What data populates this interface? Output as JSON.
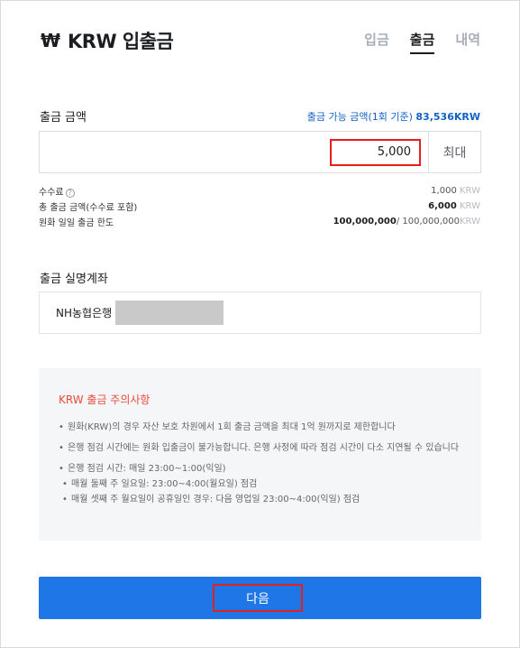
{
  "header": {
    "currency_symbol": "₩",
    "title": "KRW 입출금",
    "tabs": [
      {
        "label": "입금",
        "active": false
      },
      {
        "label": "출금",
        "active": true
      },
      {
        "label": "내역",
        "active": false
      }
    ]
  },
  "withdraw": {
    "amount_label": "출금 금액",
    "available_label": "출금 가능 금액(1회 기준)",
    "available_value": "83,536",
    "available_unit": "KRW",
    "amount_value": "5,000",
    "max_button": "최대"
  },
  "fees": [
    {
      "label": "수수료",
      "value": "1,000",
      "unit": "KRW",
      "bold": false
    },
    {
      "label": "총 출금 금액(수수료 포함)",
      "value": "6,000",
      "unit": "KRW",
      "bold": true
    },
    {
      "label": "원화 일일 출금 한도",
      "value_bold": "100,000,000",
      "value": "/ 100,000,000",
      "unit": "KRW"
    }
  ],
  "account": {
    "label": "출금 실명계좌",
    "bank": "NH농협은행"
  },
  "notice": {
    "title": "KRW 출금 주의사항",
    "items": [
      "원화(KRW)의 경우 자산 보호 차원에서 1회 출금 금액을 최대 1억 원까지로 제한합니다",
      "은행 점검 시간에는 원화 입출금이 불가능합니다. 은행 사정에 따라 점검 시간이 다소 지연될 수 있습니다",
      "은행 점검 시간: 매일 23:00~1:00(익일)",
      "매월 둘째 주 일요일: 23:00~4:00(월요일) 점검",
      "매월 셋째 주 월요일이 공휴일인 경우: 다음 영업일 23:00~4:00(익일) 점검"
    ]
  },
  "next_button": "다음",
  "colors": {
    "primary": "#1e76e7",
    "highlight_border": "#e61e1e",
    "notice_title": "#e94b3c",
    "link": "#1261c4"
  }
}
